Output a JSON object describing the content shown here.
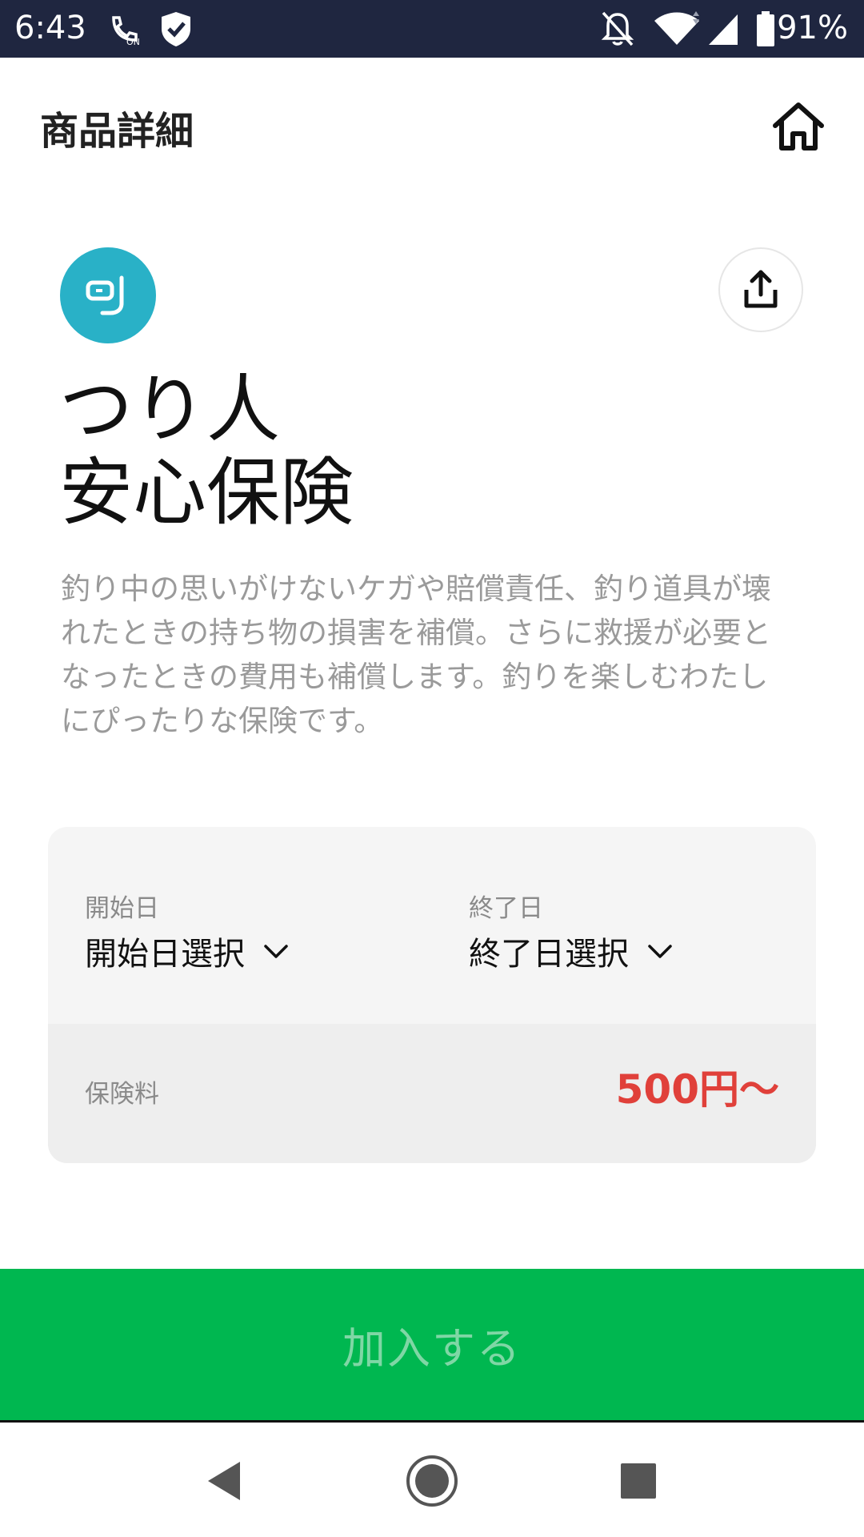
{
  "status_bar": {
    "time": "6:43",
    "battery_percent": "91%",
    "icons": [
      "call-on-icon",
      "shield-check-icon",
      "mute-bell-icon",
      "wifi-icon",
      "signal-icon",
      "battery-icon"
    ]
  },
  "header": {
    "title": "商品詳細",
    "home_icon": "home-icon"
  },
  "product": {
    "icon": "snorkel-icon",
    "icon_color": "#29b1c7",
    "share_icon": "share-icon",
    "name_line1": "つり人",
    "name_line2": "安心保険",
    "description": "釣り中の思いがけないケガや賠償責任、釣り道具が壊れたときの持ち物の損害を補償。さらに救援が必要となったときの費用も補償します。釣りを楽しむわたしにぴったりな保険です。"
  },
  "dates": {
    "start_label": "開始日",
    "start_value": "開始日選択",
    "end_label": "終了日",
    "end_value": "終了日選択"
  },
  "price": {
    "label": "保険料",
    "value": "500円〜",
    "color": "#e0403a"
  },
  "join_button": {
    "label": "加入する",
    "background": "#00b750"
  },
  "nav": {
    "back_icon": "back-icon",
    "home_icon": "home-circle-icon",
    "recents_icon": "recents-icon"
  }
}
